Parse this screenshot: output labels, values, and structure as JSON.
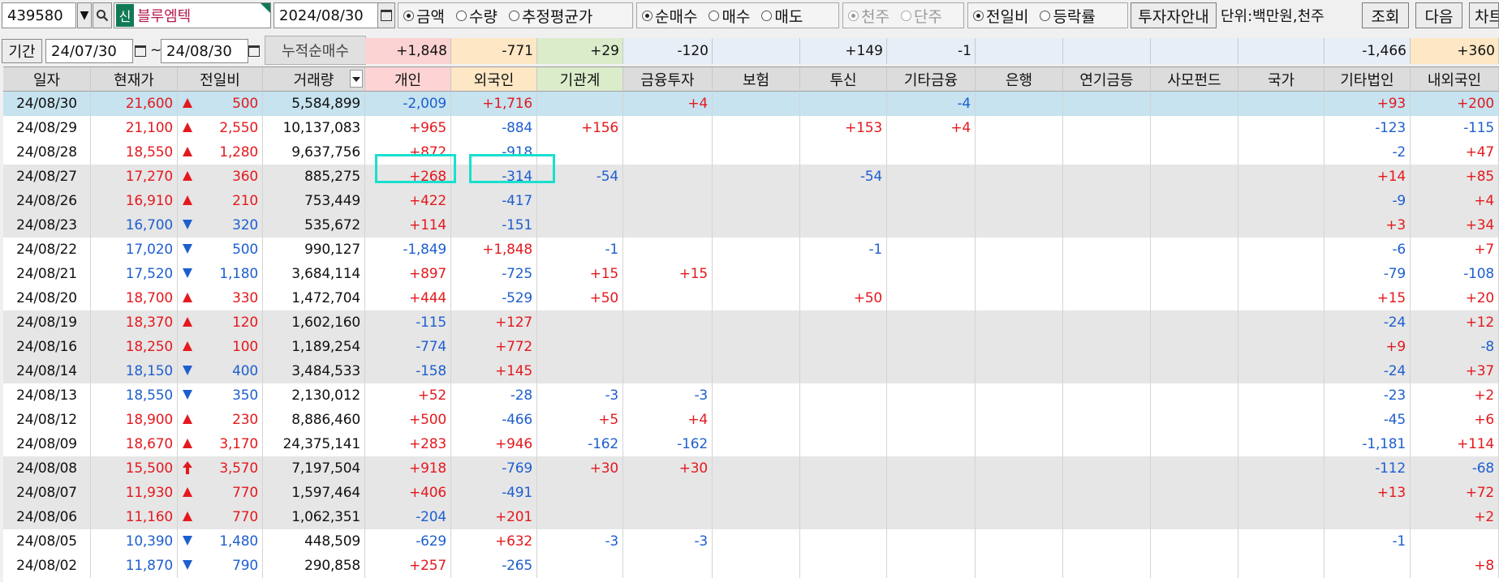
{
  "toolbar": {
    "stock_code": "439580",
    "market_badge": "신",
    "stock_name": "블루엠텍",
    "date": "2024/08/30",
    "value_type": [
      {
        "label": "금액",
        "checked": true
      },
      {
        "label": "수량",
        "checked": false
      },
      {
        "label": "추정평균가",
        "checked": false
      }
    ],
    "trade_type": [
      {
        "label": "순매수",
        "checked": true
      },
      {
        "label": "매수",
        "checked": false
      },
      {
        "label": "매도",
        "checked": false
      }
    ],
    "share_unit": [
      {
        "label": "천주",
        "checked": true
      },
      {
        "label": "단주",
        "checked": false
      }
    ],
    "compare_type": [
      {
        "label": "전일비",
        "checked": true
      },
      {
        "label": "등락률",
        "checked": false
      }
    ],
    "investor_guide_button": "투자자안내",
    "unit_label": "단위:백만원,천주",
    "search_button": "조회",
    "next_button": "다음",
    "chart_button": "차트"
  },
  "period": {
    "label": "기간",
    "start_date": "24/07/30",
    "separator": "~",
    "end_date": "24/08/30",
    "cumulative_label": "누적순매수"
  },
  "cumulative": [
    "+1,848",
    "-771",
    "+29",
    "-120",
    "",
    "+149",
    "-1",
    "",
    "",
    "",
    "",
    "-1,466",
    "+360"
  ],
  "table": {
    "headers": [
      "일자",
      "현재가",
      "전일비",
      "거래량",
      "개인",
      "외국인",
      "기관계",
      "금융투자",
      "보험",
      "투신",
      "기타금융",
      "은행",
      "연기금등",
      "사모펀드",
      "국가",
      "기타법인",
      "내외국인"
    ],
    "rows": [
      {
        "date": "24/08/30",
        "price": "21,600",
        "dir": "up",
        "change": "500",
        "volume": "5,584,899",
        "v": [
          "-2,009",
          "+1,716",
          "",
          "+4",
          "",
          "",
          "-4",
          "",
          "",
          "",
          "",
          "+93",
          "+200"
        ]
      },
      {
        "date": "24/08/29",
        "price": "21,100",
        "dir": "up",
        "change": "2,550",
        "volume": "10,137,083",
        "v": [
          "+965",
          "-884",
          "+156",
          "",
          "",
          "+153",
          "+4",
          "",
          "",
          "",
          "",
          "-123",
          "-115"
        ]
      },
      {
        "date": "24/08/28",
        "price": "18,550",
        "dir": "up",
        "change": "1,280",
        "volume": "9,637,756",
        "v": [
          "+872",
          "-918",
          "",
          "",
          "",
          "",
          "",
          "",
          "",
          "",
          "",
          "-2",
          "+47"
        ]
      },
      {
        "date": "24/08/27",
        "price": "17,270",
        "dir": "up",
        "change": "360",
        "volume": "885,275",
        "v": [
          "+268",
          "-314",
          "-54",
          "",
          "",
          "-54",
          "",
          "",
          "",
          "",
          "",
          "+14",
          "+85"
        ]
      },
      {
        "date": "24/08/26",
        "price": "16,910",
        "dir": "up",
        "change": "210",
        "volume": "753,449",
        "v": [
          "+422",
          "-417",
          "",
          "",
          "",
          "",
          "",
          "",
          "",
          "",
          "",
          "-9",
          "+4"
        ]
      },
      {
        "date": "24/08/23",
        "price": "16,700",
        "dir": "down",
        "change": "320",
        "volume": "535,672",
        "v": [
          "+114",
          "-151",
          "",
          "",
          "",
          "",
          "",
          "",
          "",
          "",
          "",
          "+3",
          "+34"
        ]
      },
      {
        "date": "24/08/22",
        "price": "17,020",
        "dir": "down",
        "change": "500",
        "volume": "990,127",
        "v": [
          "-1,849",
          "+1,848",
          "-1",
          "",
          "",
          "-1",
          "",
          "",
          "",
          "",
          "",
          "-6",
          "+7"
        ]
      },
      {
        "date": "24/08/21",
        "price": "17,520",
        "dir": "down",
        "change": "1,180",
        "volume": "3,684,114",
        "v": [
          "+897",
          "-725",
          "+15",
          "+15",
          "",
          "",
          "",
          "",
          "",
          "",
          "",
          "-79",
          "-108"
        ]
      },
      {
        "date": "24/08/20",
        "price": "18,700",
        "dir": "up",
        "change": "330",
        "volume": "1,472,704",
        "v": [
          "+444",
          "-529",
          "+50",
          "",
          "",
          "+50",
          "",
          "",
          "",
          "",
          "",
          "+15",
          "+20"
        ]
      },
      {
        "date": "24/08/19",
        "price": "18,370",
        "dir": "up",
        "change": "120",
        "volume": "1,602,160",
        "v": [
          "-115",
          "+127",
          "",
          "",
          "",
          "",
          "",
          "",
          "",
          "",
          "",
          "-24",
          "+12"
        ]
      },
      {
        "date": "24/08/16",
        "price": "18,250",
        "dir": "up",
        "change": "100",
        "volume": "1,189,254",
        "v": [
          "-774",
          "+772",
          "",
          "",
          "",
          "",
          "",
          "",
          "",
          "",
          "",
          "+9",
          "-8"
        ]
      },
      {
        "date": "24/08/14",
        "price": "18,150",
        "dir": "down",
        "change": "400",
        "volume": "3,484,533",
        "v": [
          "-158",
          "+145",
          "",
          "",
          "",
          "",
          "",
          "",
          "",
          "",
          "",
          "-24",
          "+37"
        ]
      },
      {
        "date": "24/08/13",
        "price": "18,550",
        "dir": "down",
        "change": "350",
        "volume": "2,130,012",
        "v": [
          "+52",
          "-28",
          "-3",
          "-3",
          "",
          "",
          "",
          "",
          "",
          "",
          "",
          "-23",
          "+2"
        ]
      },
      {
        "date": "24/08/12",
        "price": "18,900",
        "dir": "up",
        "change": "230",
        "volume": "8,886,460",
        "v": [
          "+500",
          "-466",
          "+5",
          "+4",
          "",
          "",
          "",
          "",
          "",
          "",
          "",
          "-45",
          "+6"
        ]
      },
      {
        "date": "24/08/09",
        "price": "18,670",
        "dir": "up",
        "change": "3,170",
        "volume": "24,375,141",
        "v": [
          "+283",
          "+946",
          "-162",
          "-162",
          "",
          "",
          "",
          "",
          "",
          "",
          "",
          "-1,181",
          "+114"
        ]
      },
      {
        "date": "24/08/08",
        "price": "15,500",
        "dir": "upper",
        "change": "3,570",
        "volume": "7,197,504",
        "v": [
          "+918",
          "-769",
          "+30",
          "+30",
          "",
          "",
          "",
          "",
          "",
          "",
          "",
          "-112",
          "-68"
        ]
      },
      {
        "date": "24/08/07",
        "price": "11,930",
        "dir": "up",
        "change": "770",
        "volume": "1,597,464",
        "v": [
          "+406",
          "-491",
          "",
          "",
          "",
          "",
          "",
          "",
          "",
          "",
          "",
          "+13",
          "+72"
        ]
      },
      {
        "date": "24/08/06",
        "price": "11,160",
        "dir": "up",
        "change": "770",
        "volume": "1,062,351",
        "v": [
          "-204",
          "+201",
          "",
          "",
          "",
          "",
          "",
          "",
          "",
          "",
          "",
          "",
          "+2"
        ]
      },
      {
        "date": "24/08/05",
        "price": "10,390",
        "dir": "down",
        "change": "1,480",
        "volume": "448,509",
        "v": [
          "-629",
          "+632",
          "-3",
          "-3",
          "",
          "",
          "",
          "",
          "",
          "",
          "",
          "-1",
          ""
        ]
      },
      {
        "date": "24/08/02",
        "price": "11,870",
        "dir": "down",
        "change": "790",
        "volume": "290,858",
        "v": [
          "+257",
          "-265",
          "",
          "",
          "",
          "",
          "",
          "",
          "",
          "",
          "",
          "",
          "+8"
        ]
      }
    ]
  },
  "colors": {
    "up": "#e4191e",
    "down": "#1e5fd0",
    "selected_row": "#c6e3ef",
    "highlight_box": "#17e0cf",
    "individual_header": "#fdd3d3",
    "foreign_header": "#fde7c5",
    "institution_header": "#dbeccb"
  },
  "icons": {
    "search": "magnifier-icon",
    "dropdown": "chevron-down-icon",
    "calendar": "calendar-icon",
    "up": "triangle-up-icon",
    "down": "triangle-down-icon",
    "upper_limit": "arrow-up-icon"
  }
}
